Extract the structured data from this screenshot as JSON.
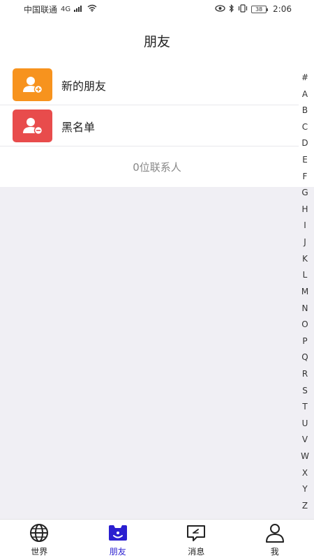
{
  "status_bar": {
    "carrier": "中国联通",
    "network": "4G",
    "battery": "38",
    "time": "2:06",
    "icons": [
      "signal-icon",
      "wifi-icon",
      "eye-icon",
      "bluetooth-icon",
      "vibrate-icon",
      "battery-icon"
    ]
  },
  "header": {
    "title": "朋友"
  },
  "list": {
    "items": [
      {
        "label": "新的朋友",
        "icon": "add-friend-icon",
        "color": "#f7931e"
      },
      {
        "label": "黑名单",
        "icon": "blacklist-icon",
        "color": "#e84c4c"
      }
    ],
    "count_text": "0位联系人"
  },
  "index_letters": [
    "#",
    "A",
    "B",
    "C",
    "D",
    "E",
    "F",
    "G",
    "H",
    "I",
    "J",
    "K",
    "L",
    "M",
    "N",
    "O",
    "P",
    "Q",
    "R",
    "S",
    "T",
    "U",
    "V",
    "W",
    "X",
    "Y",
    "Z"
  ],
  "tabbar": {
    "active_color": "#2b1fd0",
    "tabs": [
      {
        "label": "世界",
        "icon": "globe-icon"
      },
      {
        "label": "朋友",
        "icon": "friends-icon",
        "active": true
      },
      {
        "label": "消息",
        "icon": "message-icon"
      },
      {
        "label": "我",
        "icon": "person-icon"
      }
    ]
  }
}
